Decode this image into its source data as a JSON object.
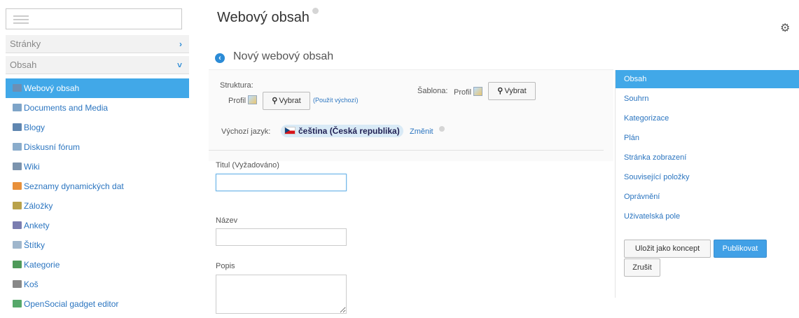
{
  "sidebar": {
    "panels": [
      {
        "label": "Stránky",
        "chevron": "›"
      },
      {
        "label": "Obsah",
        "chevron": "˅"
      }
    ],
    "items": [
      {
        "label": "Webový obsah",
        "icon": "web-content-icon",
        "color": "#6c8fb5"
      },
      {
        "label": "Documents and Media",
        "icon": "documents-icon",
        "color": "#7ea4c8"
      },
      {
        "label": "Blogy",
        "icon": "blogs-icon",
        "color": "#5f86b0"
      },
      {
        "label": "Diskusní fórum",
        "icon": "forum-icon",
        "color": "#8aaccb"
      },
      {
        "label": "Wiki",
        "icon": "wiki-icon",
        "color": "#7b93ad"
      },
      {
        "label": "Seznamy dynamických dat",
        "icon": "ddl-icon",
        "color": "#e8903a"
      },
      {
        "label": "Záložky",
        "icon": "bookmarks-icon",
        "color": "#b9a24a"
      },
      {
        "label": "Ankety",
        "icon": "polls-icon",
        "color": "#7a7db0"
      },
      {
        "label": "Štítky",
        "icon": "tags-icon",
        "color": "#9fb6cc"
      },
      {
        "label": "Kategorie",
        "icon": "categories-icon",
        "color": "#4f9a5a"
      },
      {
        "label": "Koš",
        "icon": "trash-icon",
        "color": "#888888"
      },
      {
        "label": "OpenSocial gadget editor",
        "icon": "gadget-icon",
        "color": "#56a86a"
      }
    ]
  },
  "header": {
    "title": "Webový obsah",
    "subtitle": "Nový webový obsah"
  },
  "form": {
    "structure_label": "Struktura:",
    "structure_value": "Profil",
    "select_label": "Vybrat",
    "use_default_link": "(Použít výchozí)",
    "template_label": "Šablona:",
    "template_value": "Profil",
    "default_language_label": "Výchozí jazyk:",
    "default_language_value": "čeština (Česká republika)",
    "change_link": "Změnit",
    "title_label": "Titul (Vyžadováno)",
    "title_value": "",
    "name_label": "Název",
    "name_value": "",
    "description_label": "Popis",
    "description_value": ""
  },
  "right_panel": {
    "sections": [
      "Obsah",
      "Souhrn",
      "Kategorizace",
      "Plán",
      "Stránka zobrazení",
      "Související položky",
      "Oprávnění",
      "Uživatelská pole"
    ],
    "active_section": "Obsah",
    "save_draft_label": "Uložit jako koncept",
    "publish_label": "Publikovat",
    "cancel_label": "Zrušit"
  },
  "colors": {
    "accent": "#41a8e8",
    "link": "#2b75c0"
  }
}
